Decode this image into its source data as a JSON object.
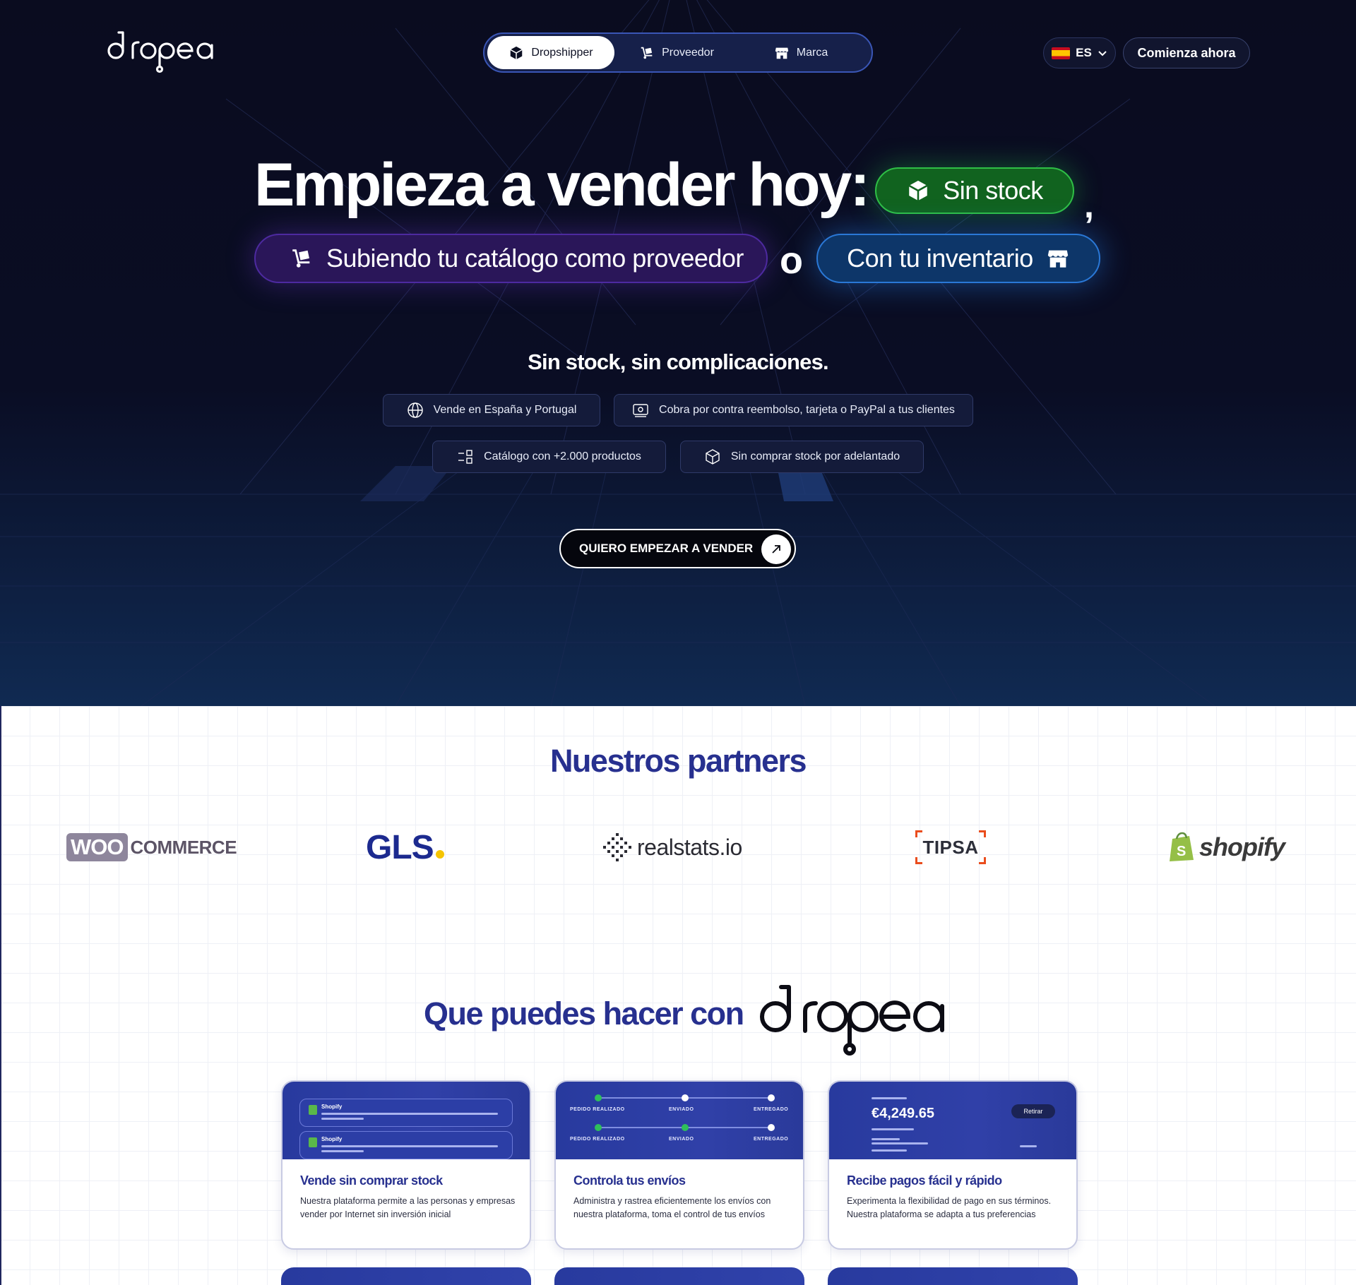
{
  "header": {
    "logo_text": "dropea",
    "nav_tabs": [
      {
        "label": "Dropshipper",
        "active": true,
        "icon": "box-icon"
      },
      {
        "label": "Proveedor",
        "active": false,
        "icon": "hand-truck-icon"
      },
      {
        "label": "Marca",
        "active": false,
        "icon": "store-icon"
      }
    ],
    "language": "ES",
    "cta_label": "Comienza ahora"
  },
  "hero": {
    "headline": "Empieza a vender hoy:",
    "pill_stock": "Sin stock",
    "comma": ",",
    "pill_supplier": "Subiendo tu catálogo como proveedor",
    "or_word": "o",
    "pill_inventory": "Con tu inventario",
    "subheadline": "Sin stock, sin complicaciones.",
    "features": [
      {
        "label": "Vende en España y Portugal",
        "icon": "globe-icon"
      },
      {
        "label": "Cobra por contra reembolso, tarjeta o PayPal a tus clientes",
        "icon": "cash-icon"
      },
      {
        "label": "Catálogo con +2.000 productos",
        "icon": "catalog-icon"
      },
      {
        "label": "Sin comprar stock por adelantado",
        "icon": "package-icon"
      }
    ],
    "cta_label": "QUIERO EMPEZAR A VENDER",
    "colors": {
      "green_pill": "#11631f",
      "purple_pill": "#2a1659",
      "blue_pill": "#0d3669",
      "background": "#0a0c1f"
    }
  },
  "partners": {
    "title": "Nuestros partners",
    "logos": [
      {
        "box": "WOO",
        "text": "COMMERCE"
      },
      {
        "text": "GLS"
      },
      {
        "text": "realstats.io"
      },
      {
        "text": "TIPSA"
      },
      {
        "text": "shopify"
      }
    ]
  },
  "features_section": {
    "title": "Que puedes hacer con",
    "brand": "dropea",
    "cards": [
      {
        "title": "Vende sin comprar stock",
        "description": "Nuestra plataforma permite a las personas y empresas vender por Internet sin inversión inicial",
        "notifications": [
          "Shopify",
          "Shopify"
        ]
      },
      {
        "title": "Controla tus envíos",
        "description": "Administra y rastrea eficientemente los envíos con nuestra plataforma, toma el control de tus envíos",
        "steps": [
          "PEDIDO REALIZADO",
          "ENVIADO",
          "ENTREGADO"
        ]
      },
      {
        "title": "Recibe pagos fácil y rápido",
        "description": "Experimenta la flexibilidad de pago en sus términos. Nuestra plataforma se adapta a tus preferencias",
        "balance": "€4,249.65",
        "withdraw_label": "Retirar"
      }
    ],
    "colors": {
      "title": "#27308f",
      "card_header": "#283a9e"
    }
  }
}
